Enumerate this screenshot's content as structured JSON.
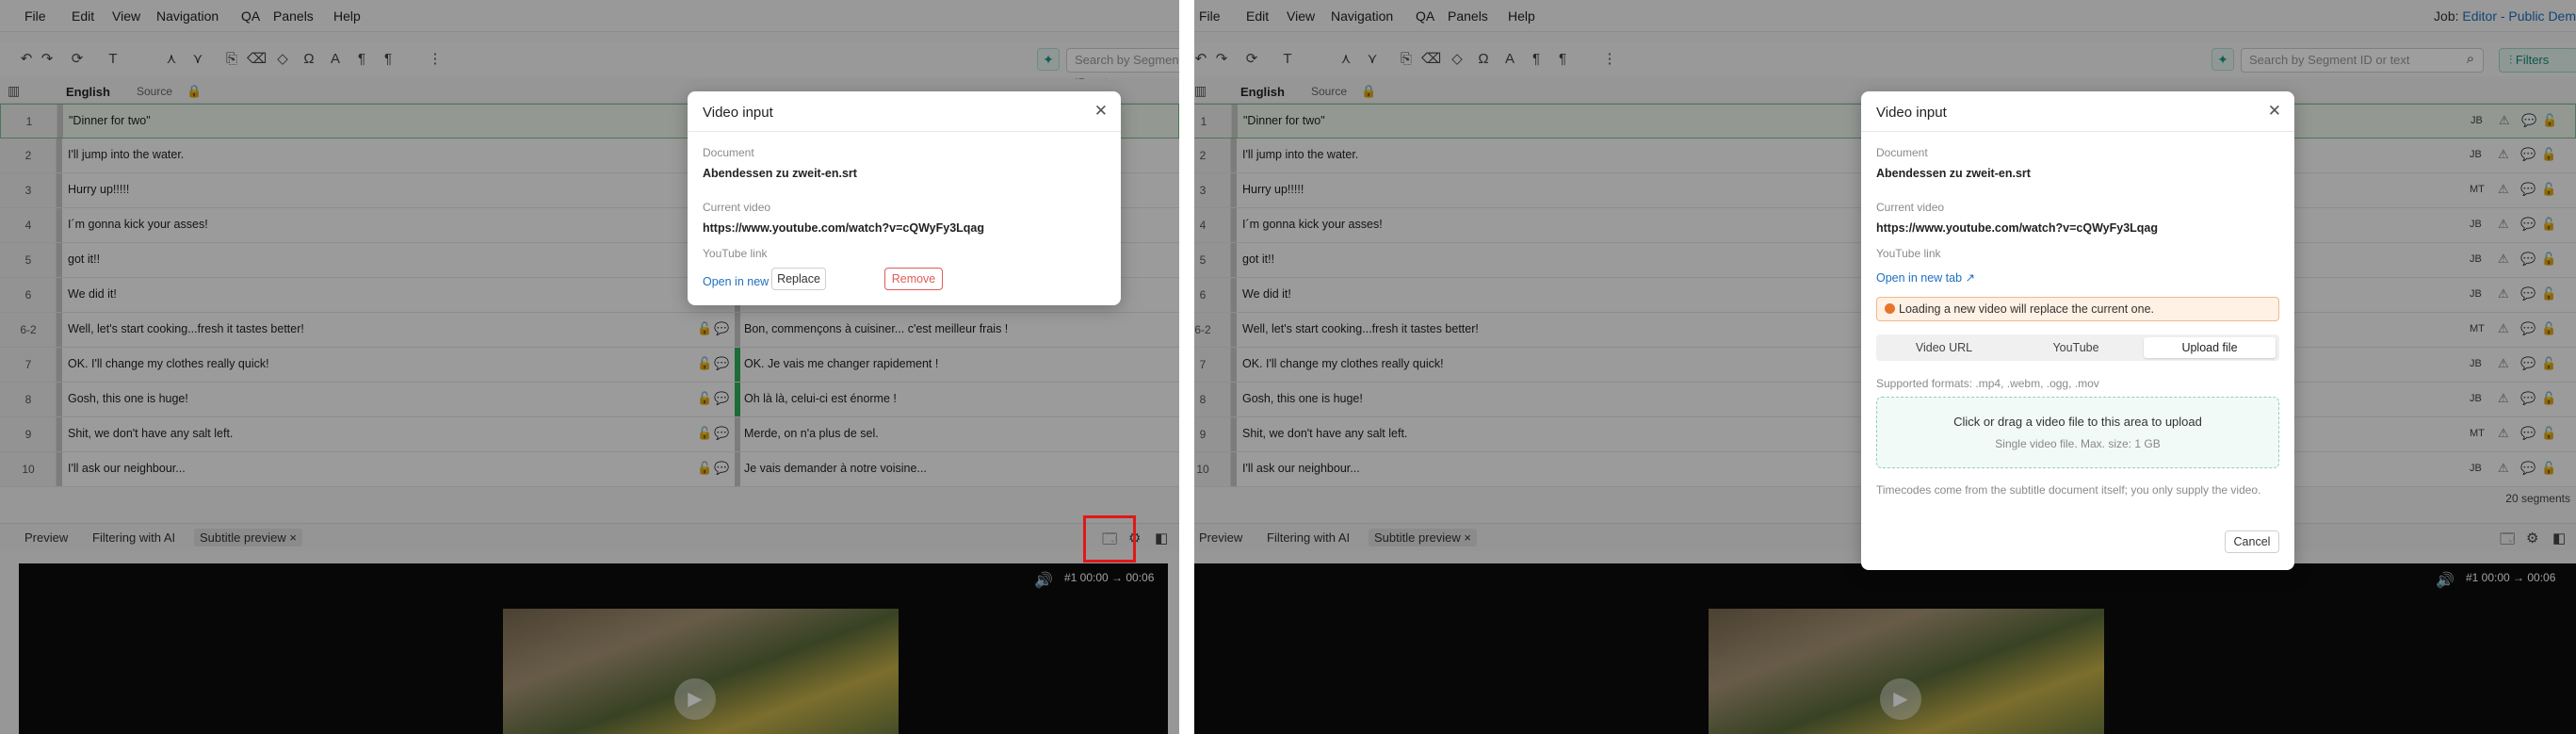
{
  "menu": [
    "File",
    "Edit",
    "View",
    "Navigation",
    "QA",
    "Panels",
    "Help"
  ],
  "job": {
    "prefix": "Job:",
    "text": "Editor - Public Dem"
  },
  "search": {
    "placeholder": "Search by Segment ID or text"
  },
  "filters_label": "Filters",
  "grid": {
    "language": "English",
    "source_label": "Source"
  },
  "rows": [
    {
      "num": "1",
      "source": "\"Dinner for two\"",
      "target": "",
      "mt": "JB"
    },
    {
      "num": "2",
      "source": "I'll jump into the water.",
      "target": "",
      "mt": "JB"
    },
    {
      "num": "3",
      "source": "Hurry up!!!!!",
      "target": "",
      "mt": "MT"
    },
    {
      "num": "4",
      "source": "I´m gonna kick your asses!",
      "target": "",
      "mt": "JB"
    },
    {
      "num": "5",
      "source": "got it!!",
      "target": "",
      "mt": "JB"
    },
    {
      "num": "6",
      "source": "We did it!",
      "target": "",
      "mt": "JB"
    },
    {
      "num": "6-2",
      "source": "Well, let's start cooking...fresh it tastes better!",
      "target": "Bon, commençons à cuisiner... c'est meilleur frais !",
      "mt": "MT"
    },
    {
      "num": "7",
      "source": "OK. I'll change my clothes really quick!",
      "target": "OK. Je vais me changer rapidement !",
      "mt": "JB"
    },
    {
      "num": "8",
      "source": "Gosh, this one is huge!",
      "target": "Oh là là, celui-ci est énorme !",
      "mt": "JB"
    },
    {
      "num": "9",
      "source": "Shit, we don't have any salt left.",
      "target": "Merde, on n'a plus de sel.",
      "mt": "MT"
    },
    {
      "num": "10",
      "source": "I'll ask our neighbour...",
      "target": "Je vais demander à notre voisine...",
      "mt": "JB"
    }
  ],
  "segment_count": "20 segments",
  "bottom_tabs": [
    "Preview",
    "Filtering with AI",
    "Subtitle preview"
  ],
  "video": {
    "time": "#1 00:00 → 00:06"
  },
  "modal_left": {
    "title": "Video input",
    "document_label": "Document",
    "document_value": "Abendessen zu zweit-en.srt",
    "current_label": "Current video",
    "current_value": "https://www.youtube.com/watch?v=cQWyFy3Lqag",
    "source_label": "YouTube link",
    "open_link": "Open in new tab",
    "replace": "Replace",
    "remove": "Remove"
  },
  "modal_right": {
    "title": "Video input",
    "document_label": "Document",
    "document_value": "Abendessen zu zweit-en.srt",
    "current_label": "Current video",
    "current_value": "https://www.youtube.com/watch?v=cQWyFy3Lqag",
    "source_label": "YouTube link",
    "open_link": "Open in new tab",
    "warning": "Loading a new video will replace the current one.",
    "tabs": [
      "Video URL",
      "YouTube",
      "Upload file"
    ],
    "formats": "Supported formats: .mp4, .webm, .ogg, .mov",
    "drop_title": "Click or drag a video file to this area to upload",
    "drop_sub": "Single video file. Max. size: 1 GB",
    "note": "Timecodes come from the subtitle document itself; you only supply the video.",
    "cancel": "Cancel"
  },
  "colors": {
    "accent": "#1a9a86",
    "link": "#1f6fbf",
    "danger": "#e05a5a",
    "highlight": "#e01818"
  }
}
